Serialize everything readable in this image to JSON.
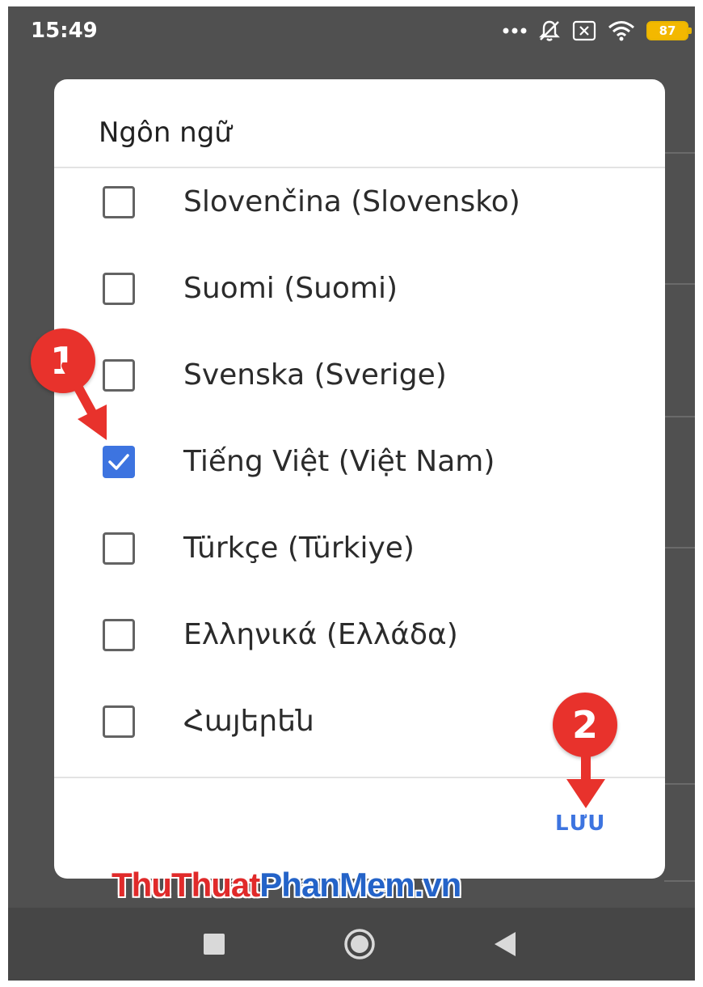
{
  "status_bar": {
    "time": "15:49",
    "battery_level": "87",
    "icons": [
      "more-dots-icon",
      "bell-muted-icon",
      "sim-disabled-icon",
      "wifi-icon",
      "battery-icon"
    ]
  },
  "dialog": {
    "title": "Ngôn ngữ",
    "languages": [
      {
        "label": "Slovenčina (Slovensko)",
        "checked": false
      },
      {
        "label": "Suomi (Suomi)",
        "checked": false
      },
      {
        "label": "Svenska (Sverige)",
        "checked": false
      },
      {
        "label": "Tiếng Việt (Việt Nam)",
        "checked": true
      },
      {
        "label": "Türkçe (Türkiye)",
        "checked": false
      },
      {
        "label": "Ελληνικά (Ελλάδα)",
        "checked": false
      },
      {
        "label": "Հայերեն",
        "checked": false
      }
    ],
    "save_label": "LƯU"
  },
  "annotations": {
    "step_1": "1",
    "step_2": "2"
  },
  "watermark": {
    "part_red": "ThuThuat",
    "part_blue": "PhanMem",
    "part_red_2": ".vn"
  },
  "colors": {
    "accent": "#3d74e0",
    "annotation_red": "#e8322c",
    "battery": "#f3b800"
  }
}
